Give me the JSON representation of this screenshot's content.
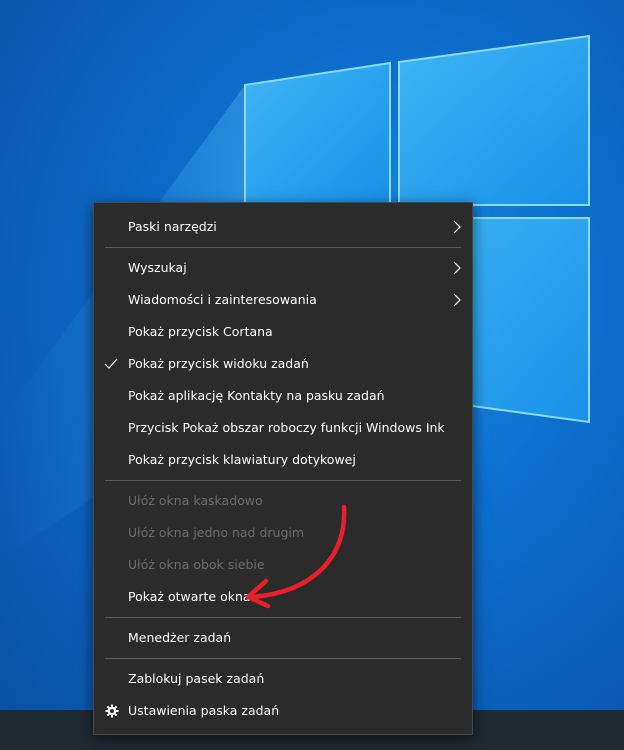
{
  "colors": {
    "desktop_blue": "#0c6fd0",
    "menu_background": "#2b2b2b",
    "menu_text": "#ffffff",
    "menu_text_disabled": "#6d6d6d",
    "separator": "#5a5a5a",
    "annotation_arrow": "#e8202a"
  },
  "icons": {
    "submenu": "chevron-right-icon",
    "checked": "checkmark-icon",
    "settings": "gear-icon"
  },
  "context_menu": {
    "toolbars": "Paski narzędzi",
    "search": "Wyszukaj",
    "news_and_interests": "Wiadomości i zainteresowania",
    "show_cortana_button": "Pokaż przycisk Cortana",
    "show_task_view_button": "Pokaż przycisk widoku zadań",
    "show_people": "Pokaż aplikację Kontakty na pasku zadań",
    "show_windows_ink": "Przycisk Pokaż obszar roboczy funkcji Windows Ink",
    "show_touch_keyboard": "Pokaż przycisk klawiatury dotykowej",
    "cascade_windows": "Ułóż okna kaskadowo",
    "stack_windows": "Ułóż okna jedno nad drugim",
    "side_by_side_windows": "Ułóż okna obok siebie",
    "show_open_windows": "Pokaż otwarte okna",
    "task_manager": "Menedżer zadań",
    "lock_taskbar": "Zablokuj pasek zadań",
    "taskbar_settings": "Ustawienia paska zadań"
  }
}
